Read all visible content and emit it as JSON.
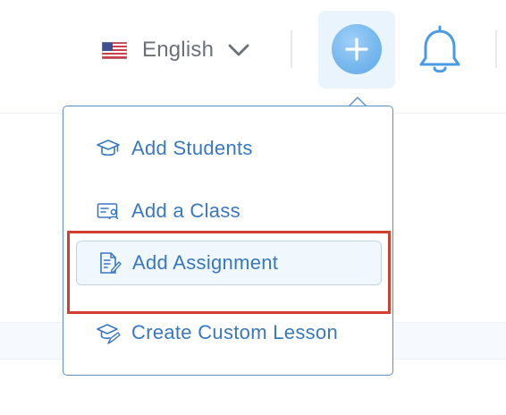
{
  "header": {
    "language": {
      "label": "English",
      "flag_icon": "us-flag-icon",
      "chevron_icon": "chevron-down-icon"
    },
    "add_button": {
      "icon": "plus-icon"
    },
    "notifications": {
      "icon": "bell-icon"
    }
  },
  "dropdown": {
    "items": [
      {
        "label": "Add Students",
        "icon": "graduation-cap-icon",
        "selected": false
      },
      {
        "label": "Add a Class",
        "icon": "class-card-icon",
        "selected": false
      },
      {
        "label": "Add Assignment",
        "icon": "assignment-document-icon",
        "selected": true
      },
      {
        "label": "Create Custom Lesson",
        "icon": "lesson-cap-pencil-icon",
        "selected": false
      }
    ]
  },
  "colors": {
    "menu_text": "#3878c0",
    "menu_border": "#5a8fc8",
    "highlight_border": "#d23f2e",
    "add_button_bg": "#e9f4fd",
    "add_circle": "#78b8ee",
    "bell": "#4a9be6"
  }
}
